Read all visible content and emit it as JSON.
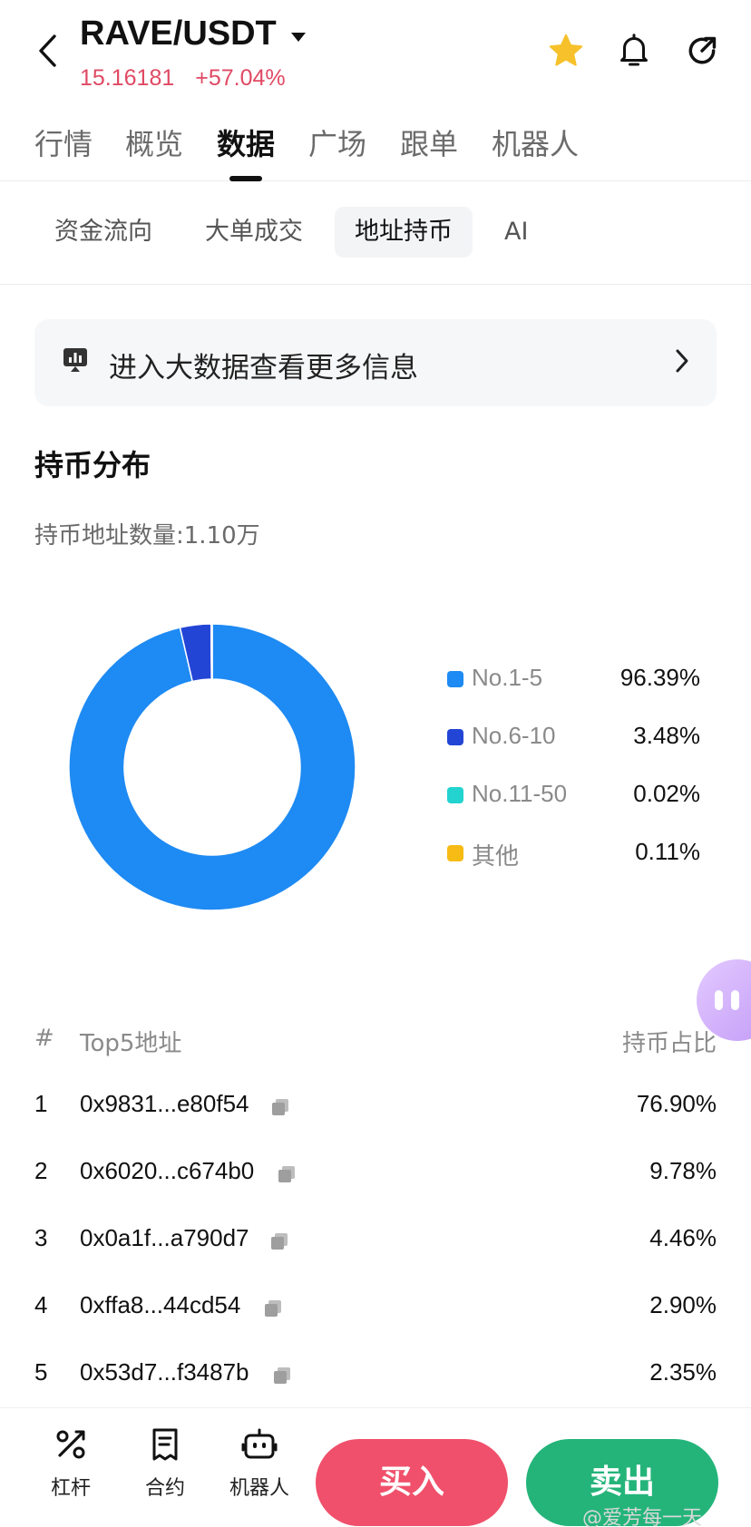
{
  "header": {
    "pair": "RAVE/USDT",
    "price": "15.16181",
    "change": "+57.04%",
    "icons": [
      "back-icon",
      "caret-down-icon",
      "star-icon",
      "bell-icon",
      "share-icon"
    ],
    "colors": {
      "price": "#e04a64",
      "star": "#f6c12b"
    }
  },
  "main_tabs": [
    {
      "label": "行情"
    },
    {
      "label": "概览"
    },
    {
      "label": "数据",
      "active": true
    },
    {
      "label": "广场"
    },
    {
      "label": "跟单"
    },
    {
      "label": "机器人"
    }
  ],
  "sub_tabs": [
    {
      "label": "资金流向"
    },
    {
      "label": "大单成交"
    },
    {
      "label": "地址持币",
      "active": true
    },
    {
      "label": "AI"
    }
  ],
  "banner": {
    "text": "进入大数据查看更多信息",
    "icon": "big-data-icon"
  },
  "distribution": {
    "title": "持币分布",
    "address_count_label": "持币地址数量:",
    "address_count_value": "1.10万"
  },
  "chart_data": {
    "type": "pie",
    "style": "donut",
    "categories": [
      "No.1-5",
      "No.6-10",
      "No.11-50",
      "其他"
    ],
    "values": [
      96.39,
      3.48,
      0.02,
      0.11
    ],
    "labels": [
      "96.39%",
      "3.48%",
      "0.02%",
      "0.11%"
    ],
    "colors": [
      "#1e8af3",
      "#2345d6",
      "#22d3cf",
      "#f7bb16"
    ],
    "legend_position": "right"
  },
  "holders": {
    "headers": {
      "index": "#",
      "address": "Top5地址",
      "ratio": "持币占比"
    },
    "rows": [
      {
        "index": "1",
        "address": "0x9831...e80f54",
        "ratio": "76.90%"
      },
      {
        "index": "2",
        "address": "0x6020...c674b0",
        "ratio": "9.78%"
      },
      {
        "index": "3",
        "address": "0x0a1f...a790d7",
        "ratio": "4.46%"
      },
      {
        "index": "4",
        "address": "0xffa8...44cd54",
        "ratio": "2.90%"
      },
      {
        "index": "5",
        "address": "0x53d7...f3487b",
        "ratio": "2.35%"
      }
    ]
  },
  "bottom_bar": {
    "items": [
      {
        "label": "杠杆",
        "icon": "leverage-icon"
      },
      {
        "label": "合约",
        "icon": "contract-icon"
      },
      {
        "label": "机器人",
        "icon": "robot-icon"
      }
    ],
    "buy_label": "买入",
    "sell_label": "卖出",
    "colors": {
      "buy": "#f0506b",
      "sell": "#24b47a"
    }
  },
  "watermark": "@爱芳每一天"
}
